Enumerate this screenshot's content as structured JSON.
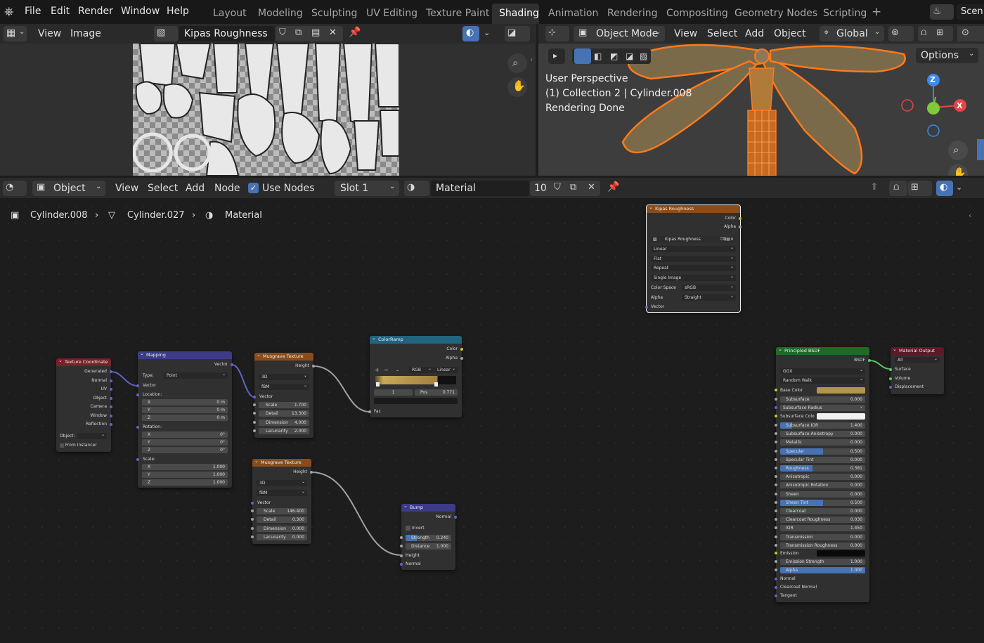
{
  "menus": [
    "File",
    "Edit",
    "Render",
    "Window",
    "Help"
  ],
  "workspaces": [
    "Layout",
    "Modeling",
    "Sculpting",
    "UV Editing",
    "Texture Paint",
    "Shading",
    "Animation",
    "Rendering",
    "Compositing",
    "Geometry Nodes",
    "Scripting"
  ],
  "active_workspace": "Shading",
  "scene_label": "Scen",
  "image_editor": {
    "view": "View",
    "image": "Image",
    "image_name": "Kipas Roughness"
  },
  "viewport": {
    "mode": "Object Mode",
    "menus": [
      "View",
      "Select",
      "Add",
      "Object"
    ],
    "orientation": "Global",
    "options": "Options",
    "overlay_lines": [
      "User Perspective",
      "(1) Collection 2 | Cylinder.008",
      "Rendering Done"
    ],
    "axes": {
      "z": "Z",
      "x": "X"
    }
  },
  "node_header": {
    "object": "Object",
    "menus": [
      "View",
      "Select",
      "Add",
      "Node"
    ],
    "use_nodes": "Use Nodes",
    "slot": "Slot 1",
    "material": "Material",
    "users": "10"
  },
  "breadcrumb": [
    "Cylinder.008",
    "Cylinder.027",
    "Material"
  ],
  "nodes": {
    "image_tex": {
      "title": "Kipas Roughness",
      "outs": [
        "Color",
        "Alpha"
      ],
      "image": "Kipas Roughness",
      "interp": "Linear",
      "proj": "Flat",
      "ext": "Repeat",
      "source": "Single Image",
      "cs_label": "Color Space",
      "cs_value": "sRGB",
      "alpha_label": "Alpha",
      "alpha_value": "Straight",
      "vector": "Vector"
    },
    "tex_coord": {
      "title": "Texture Coordinate",
      "outs": [
        "Generated",
        "Normal",
        "UV",
        "Object",
        "Camera",
        "Window",
        "Reflection"
      ],
      "object_label": "Object:",
      "instancer": "From Instancer"
    },
    "mapping": {
      "title": "Mapping",
      "out": "Vector",
      "type_label": "Type:",
      "type_value": "Point",
      "vector": "Vector",
      "location": "Location:",
      "loc": [
        [
          "X",
          "0 m"
        ],
        [
          "Y",
          "0 m"
        ],
        [
          "Z",
          "0 m"
        ]
      ],
      "rotation": "Rotation:",
      "rot": [
        [
          "X",
          "0°"
        ],
        [
          "Y",
          "0°"
        ],
        [
          "Z",
          "0°"
        ]
      ],
      "scale": "Scale:",
      "scl": [
        [
          "X",
          "1.000"
        ],
        [
          "Y",
          "1.000"
        ],
        [
          "Z",
          "1.000"
        ]
      ]
    },
    "musgrave1": {
      "title": "Musgrave Texture",
      "out": "Height",
      "dim": "3D",
      "type": "fBM",
      "vector": "Vector",
      "fields": [
        [
          "Scale",
          "1.700"
        ],
        [
          "Detail",
          "13.300"
        ],
        [
          "Dimension",
          "4.000"
        ],
        [
          "Lacunarity",
          "2.000"
        ]
      ]
    },
    "musgrave2": {
      "title": "Musgrave Texture",
      "out": "Height",
      "dim": "3D",
      "type": "fBM",
      "vector": "Vector",
      "fields": [
        [
          "Scale",
          "146.400"
        ],
        [
          "Detail",
          "0.300"
        ],
        [
          "Dimension",
          "0.000"
        ],
        [
          "Lacunarity",
          "0.000"
        ]
      ]
    },
    "colorramp": {
      "title": "ColorRamp",
      "outs": [
        "Color",
        "Alpha"
      ],
      "plus": "+",
      "minus": "−",
      "mode": "RGB",
      "interp": "Linear",
      "index": "1",
      "pos_label": "Pos",
      "pos_value": "0.771",
      "fac": "Fac"
    },
    "bump": {
      "title": "Bump",
      "out": "Normal",
      "invert": "Invert",
      "strength_label": "Strength",
      "strength": "0.240",
      "distance_label": "Distance",
      "distance": "1.000",
      "height": "Height",
      "normal": "Normal"
    },
    "bsdf": {
      "title": "Principled BSDF",
      "out": "BSDF",
      "dist": "GGX",
      "sss_method": "Random Walk",
      "base_color": "Base Color",
      "subsurface": [
        "Subsurface",
        "0.000"
      ],
      "sss_radius": "Subsurface Radius",
      "sss_color": "Subsurface Colo",
      "fields": [
        [
          "Subsurface IOR",
          "1.400"
        ],
        [
          "Subsurface Anisotropy",
          "0.000"
        ],
        [
          "Metallic",
          "0.000"
        ],
        [
          "Specular",
          "0.500"
        ],
        [
          "Specular Tint",
          "0.000"
        ],
        [
          "Roughness",
          "0.381"
        ],
        [
          "Anisotropic",
          "0.000"
        ],
        [
          "Anisotropic Rotation",
          "0.000"
        ],
        [
          "Sheen",
          "0.000"
        ],
        [
          "Sheen Tint",
          "0.500"
        ],
        [
          "Clearcoat",
          "0.000"
        ],
        [
          "Clearcoat Roughness",
          "0.030"
        ],
        [
          "IOR",
          "1.450"
        ],
        [
          "Transmission",
          "0.000"
        ],
        [
          "Transmission Roughness",
          "0.000"
        ]
      ],
      "emission": "Emission",
      "emission_strength": [
        "Emission Strength",
        "1.000"
      ],
      "alpha": [
        "Alpha",
        "1.000"
      ],
      "inputs": [
        "Normal",
        "Clearcoat Normal",
        "Tangent"
      ]
    },
    "output": {
      "title": "Material Output",
      "target": "All",
      "ins": [
        "Surface",
        "Volume",
        "Displacement"
      ]
    }
  },
  "colors": {
    "accent": "#4772b3",
    "node_tex": "#8a4c1b",
    "node_color": "#216480",
    "node_vector": "#3b3b8a",
    "node_input": "#7a1f2a",
    "node_shader": "#1f6b26",
    "node_output": "#5a1a26",
    "selection": "#e8821c"
  }
}
